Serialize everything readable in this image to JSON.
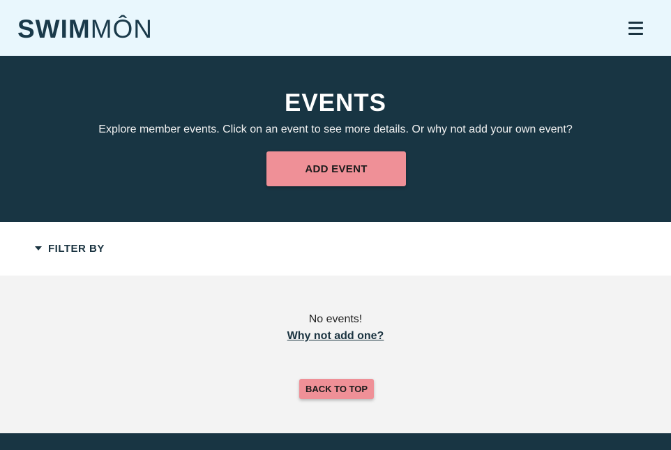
{
  "header": {
    "logo_bold": "SWIM",
    "logo_thin": "MÔN",
    "menu_icon": "hamburger-menu-icon"
  },
  "hero": {
    "title": "EVENTS",
    "description": "Explore member events. Click on an event to see more details. Or why not add your own event?",
    "add_event_label": "ADD EVENT"
  },
  "filter": {
    "label": "FILTER BY",
    "icon": "caret-down-icon"
  },
  "content": {
    "empty_message": "No events!",
    "add_one_link": "Why not add one?",
    "back_to_top_label": "BACK TO TOP"
  },
  "colors": {
    "header_bg": "#e9f7fd",
    "hero_bg": "#183543",
    "accent": "#ef9097",
    "page_bg": "#f3f3f3",
    "text_dark": "#1a3340"
  }
}
